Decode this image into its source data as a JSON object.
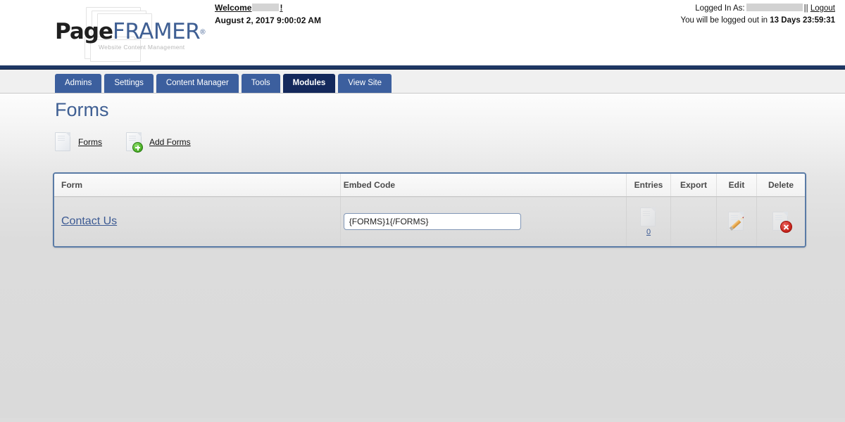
{
  "header": {
    "logo": {
      "part1": "Page",
      "part2": "FRAMER",
      "registered": "®",
      "tagline": "Website Content Management"
    },
    "welcome_prefix": "Welcome",
    "welcome_suffix": "!",
    "welcome_user": "",
    "datetime": "August 2, 2017 9:00:02 AM",
    "logged_in_label": "Logged In As:",
    "logged_in_user": "",
    "separator": "||",
    "logout_label": "Logout",
    "timeout_prefix": "You will be logged out in",
    "timeout_value": "13 Days 23:59:31"
  },
  "nav": {
    "tabs": [
      {
        "label": "Admins",
        "active": false
      },
      {
        "label": "Settings",
        "active": false
      },
      {
        "label": "Content Manager",
        "active": false
      },
      {
        "label": "Tools",
        "active": false
      },
      {
        "label": "Modules",
        "active": true
      },
      {
        "label": "View Site",
        "active": false
      }
    ]
  },
  "page": {
    "title": "Forms",
    "actions": [
      {
        "label": "Forms",
        "icon": "document-icon"
      },
      {
        "label": "Add Forms",
        "icon": "document-add-icon"
      }
    ]
  },
  "table": {
    "columns": {
      "form": "Form",
      "embed_code": "Embed Code",
      "entries": "Entries",
      "export": "Export",
      "edit": "Edit",
      "delete": "Delete"
    },
    "rows": [
      {
        "form_name": "Contact Us",
        "embed_code": "{FORMS}1{/FORMS}",
        "entries_count": "0",
        "export": "",
        "edit_icon": "document-edit-icon",
        "delete_icon": "document-delete-icon"
      }
    ]
  },
  "colors": {
    "tab_blue": "#3c5f9e",
    "tab_active_blue": "#14295c",
    "title_blue": "#3f5f93",
    "link_blue": "#3c5a93",
    "table_border": "#5a7ba6",
    "navy_bar": "#1f3864"
  }
}
